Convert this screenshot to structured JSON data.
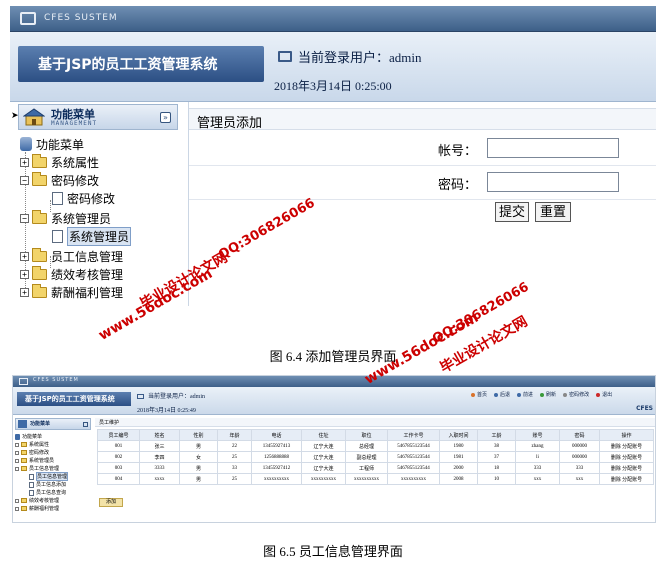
{
  "figure1": {
    "window_title": "CFES SUSTEM",
    "app_title": "基于JSP的员工工资管理系统",
    "current_user": "当前登录用户：admin",
    "datetime": "2018年3月14日  0:25:00",
    "menu_title": "功能菜单",
    "menu_subtitle": "MANAGEMENT",
    "tree": {
      "root": "功能菜单",
      "system_props": "系统属性",
      "pwd_change": "密码修改",
      "pwd_change_child": "密码修改",
      "sys_admin": "系统管理员",
      "sys_admin_child": "系统管理员",
      "emp_info": "员工信息管理",
      "perf": "绩效考核管理",
      "salary": "薪酬福利管理"
    },
    "panel_title": "管理员添加",
    "account_label": "帐号：",
    "password_label": "密码：",
    "submit_label": "提交",
    "reset_label": "重置"
  },
  "caption1": "图 6.4 添加管理员界面",
  "figure2": {
    "window_title": "CFES SUSTEM",
    "app_title": "基于JSP的员工工资管理系统",
    "current_user": "当前登录用户：admin",
    "datetime": "2018年3月14日  0:25:49",
    "brand": "CFES",
    "nav": [
      "首页",
      "后退",
      "前进",
      "刷新",
      "密码修改",
      "退出"
    ],
    "menu_title": "功能菜单",
    "tree": [
      "功能菜单",
      "系统属性",
      "密码修改",
      "系统管理员",
      "员工信息管理",
      "员工信息管理",
      "员工信息添加",
      "员工信息查询",
      "绩效考核管理",
      "薪酬福利管理"
    ],
    "panel_title": "员工维护",
    "table": {
      "headers": [
        "员工编号",
        "姓名",
        "性别",
        "年龄",
        "电话",
        "住址",
        "职位",
        "工作卡号",
        "入职时间",
        "工龄",
        "账号",
        "密码",
        "操作"
      ],
      "rows": [
        [
          "001",
          "张三",
          "男",
          "22",
          "13455927413",
          "辽宁大连",
          "总经理",
          "5467855123544",
          "1980",
          "38",
          "zhang",
          "000000",
          "删除 分配账号"
        ],
        [
          "002",
          "李四",
          "女",
          "25",
          "1256888888",
          "辽宁大连",
          "副总经理",
          "5467855123544",
          "1981",
          "37",
          "li",
          "000000",
          "删除 分配账号"
        ],
        [
          "003",
          "3333",
          "男",
          "33",
          "13455927412",
          "辽宁大连",
          "工程师",
          "5467855123544",
          "2000",
          "18",
          "333",
          "333",
          "删除 分配账号"
        ],
        [
          "004",
          "xxxx",
          "男",
          "25",
          "xxxxxxxxxx",
          "xxxxxxxxxx",
          "xxxxxxxxxx",
          "xxxxxxxxxx",
          "2008",
          "10",
          "xxx",
          "xxx",
          "删除 分配账号"
        ]
      ]
    },
    "add_label": "添加"
  },
  "caption2": "图 6.5 员工信息管理界面",
  "watermarks": {
    "site": "www.56doc.com",
    "qq": "QQ:306826066",
    "name": "毕业设计论文网"
  },
  "colors": {
    "titlebar": "#3d5f88",
    "banner": "#c9d8ea",
    "watermark": "#cc0000"
  }
}
